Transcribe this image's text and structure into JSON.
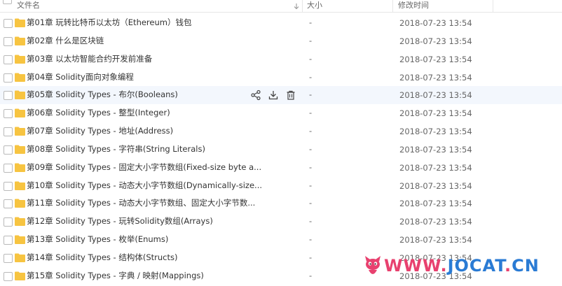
{
  "header": {
    "name_label": "文件名",
    "size_label": "大小",
    "modified_label": "修改时间"
  },
  "files": [
    {
      "name": "第01章 玩转比特币以太坊（Ethereum）钱包",
      "size": "-",
      "modified": "2018-07-23 13:54"
    },
    {
      "name": "第02章 什么是区块链",
      "size": "-",
      "modified": "2018-07-23 13:54"
    },
    {
      "name": "第03章 以太坊智能合约开发前准备",
      "size": "-",
      "modified": "2018-07-23 13:54"
    },
    {
      "name": "第04章 Solidity面向对象编程",
      "size": "-",
      "modified": "2018-07-23 13:54"
    },
    {
      "name": "第05章 Solidity Types - 布尔(Booleans)",
      "size": "-",
      "modified": "2018-07-23 13:54",
      "hover": true
    },
    {
      "name": "第06章 Solidity Types - 整型(Integer)",
      "size": "-",
      "modified": "2018-07-23 13:54"
    },
    {
      "name": "第07章 Solidity Types - 地址(Address)",
      "size": "-",
      "modified": "2018-07-23 13:54"
    },
    {
      "name": "第08章 Solidity Types - 字符串(String Literals)",
      "size": "-",
      "modified": "2018-07-23 13:54"
    },
    {
      "name": "第09章 Solidity Types - 固定大小字节数组(Fixed-size byte a...",
      "size": "-",
      "modified": "2018-07-23 13:54"
    },
    {
      "name": "第10章 Solidity Types - 动态大小字节数组(Dynamically-size...",
      "size": "-",
      "modified": "2018-07-23 13:54"
    },
    {
      "name": "第11章 Solidity Types - 动态大小字节数组、固定大小字节数...",
      "size": "-",
      "modified": "2018-07-23 13:54"
    },
    {
      "name": "第12章 Solidity Types - 玩转Solidity数组(Arrays)",
      "size": "-",
      "modified": "2018-07-23 13:54"
    },
    {
      "name": "第13章 Solidity Types - 枚举(Enums)",
      "size": "-",
      "modified": "2018-07-23 13:54"
    },
    {
      "name": "第14章 Solidity Types - 结构体(Structs)",
      "size": "-",
      "modified": "2018-07-23 13:54"
    },
    {
      "name": "第15章 Solidity Types - 字典 / 映射(Mappings)",
      "size": "-",
      "modified": "2018-07-23 13:54"
    }
  ],
  "row_actions": [
    "share-icon",
    "download-icon",
    "delete-icon"
  ],
  "watermark": {
    "www": "WWW.",
    "brand": "JOCAT",
    "dot": ".",
    "tld": "CN"
  },
  "colors": {
    "folder": "#f7c441",
    "hover_row": "#f3f7fd",
    "watermark_pink": "#e8416f",
    "watermark_blue": "#2a7bd4"
  }
}
